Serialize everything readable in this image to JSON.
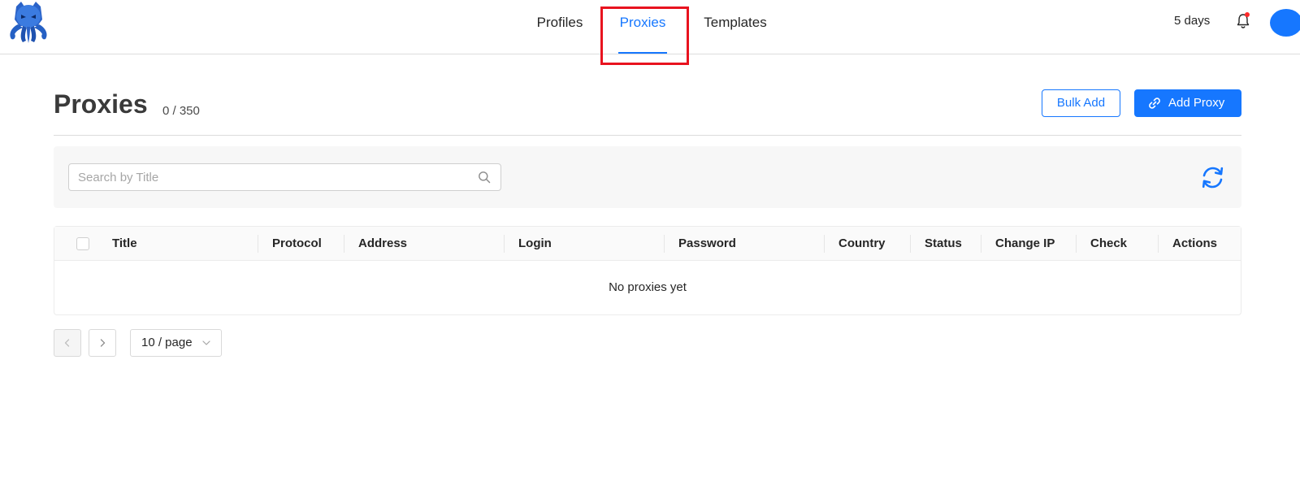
{
  "header": {
    "nav": [
      {
        "label": "Profiles",
        "active": false
      },
      {
        "label": "Proxies",
        "active": true
      },
      {
        "label": "Templates",
        "active": false
      }
    ],
    "subscription_remaining": "5 days",
    "has_notifications": true
  },
  "page": {
    "title": "Proxies",
    "count": "0 / 350",
    "bulk_add_label": "Bulk Add",
    "add_proxy_label": "Add Proxy"
  },
  "search": {
    "placeholder": "Search by Title",
    "value": ""
  },
  "table": {
    "columns": [
      "Title",
      "Protocol",
      "Address",
      "Login",
      "Password",
      "Country",
      "Status",
      "Change IP",
      "Check",
      "Actions"
    ],
    "empty_text": "No proxies yet"
  },
  "pagination": {
    "page_size": "10 / page"
  },
  "colors": {
    "accent": "#1677ff",
    "highlight": "#e8131f"
  },
  "icons": [
    "octopus-logo",
    "bell-icon",
    "link-icon",
    "search-icon",
    "refresh-icon",
    "chevron-left-icon",
    "chevron-right-icon",
    "chevron-down-icon"
  ]
}
